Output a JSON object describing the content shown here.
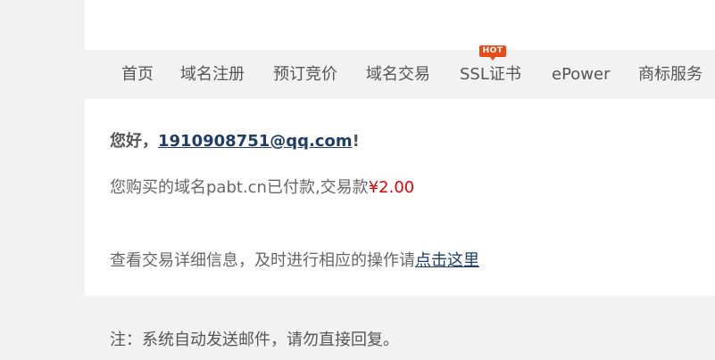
{
  "nav": {
    "items": [
      {
        "label": "首页"
      },
      {
        "label": "域名注册"
      },
      {
        "label": "预订竞价"
      },
      {
        "label": "域名交易"
      },
      {
        "label": "SSL证书"
      },
      {
        "label": "ePower"
      },
      {
        "label": "商标服务"
      }
    ],
    "hot_badge": "HOT"
  },
  "email": {
    "greeting_prefix": "您好，",
    "account": "1910908751@qq.com",
    "greeting_suffix": "!",
    "purchase_text": "您购买的域名pabt.cn已付款,交易款",
    "price": "¥2.00",
    "details_text": "查看交易详细信息，及时进行相应的操作请",
    "details_link": "点击这里",
    "note": "注：系统自动发送邮件，请勿直接回复。"
  },
  "colors": {
    "price": "#e60000",
    "link": "#1f3d66",
    "hot_badge": "#e84a18",
    "panel": "#ffffff",
    "background": "#f2f2f2"
  }
}
